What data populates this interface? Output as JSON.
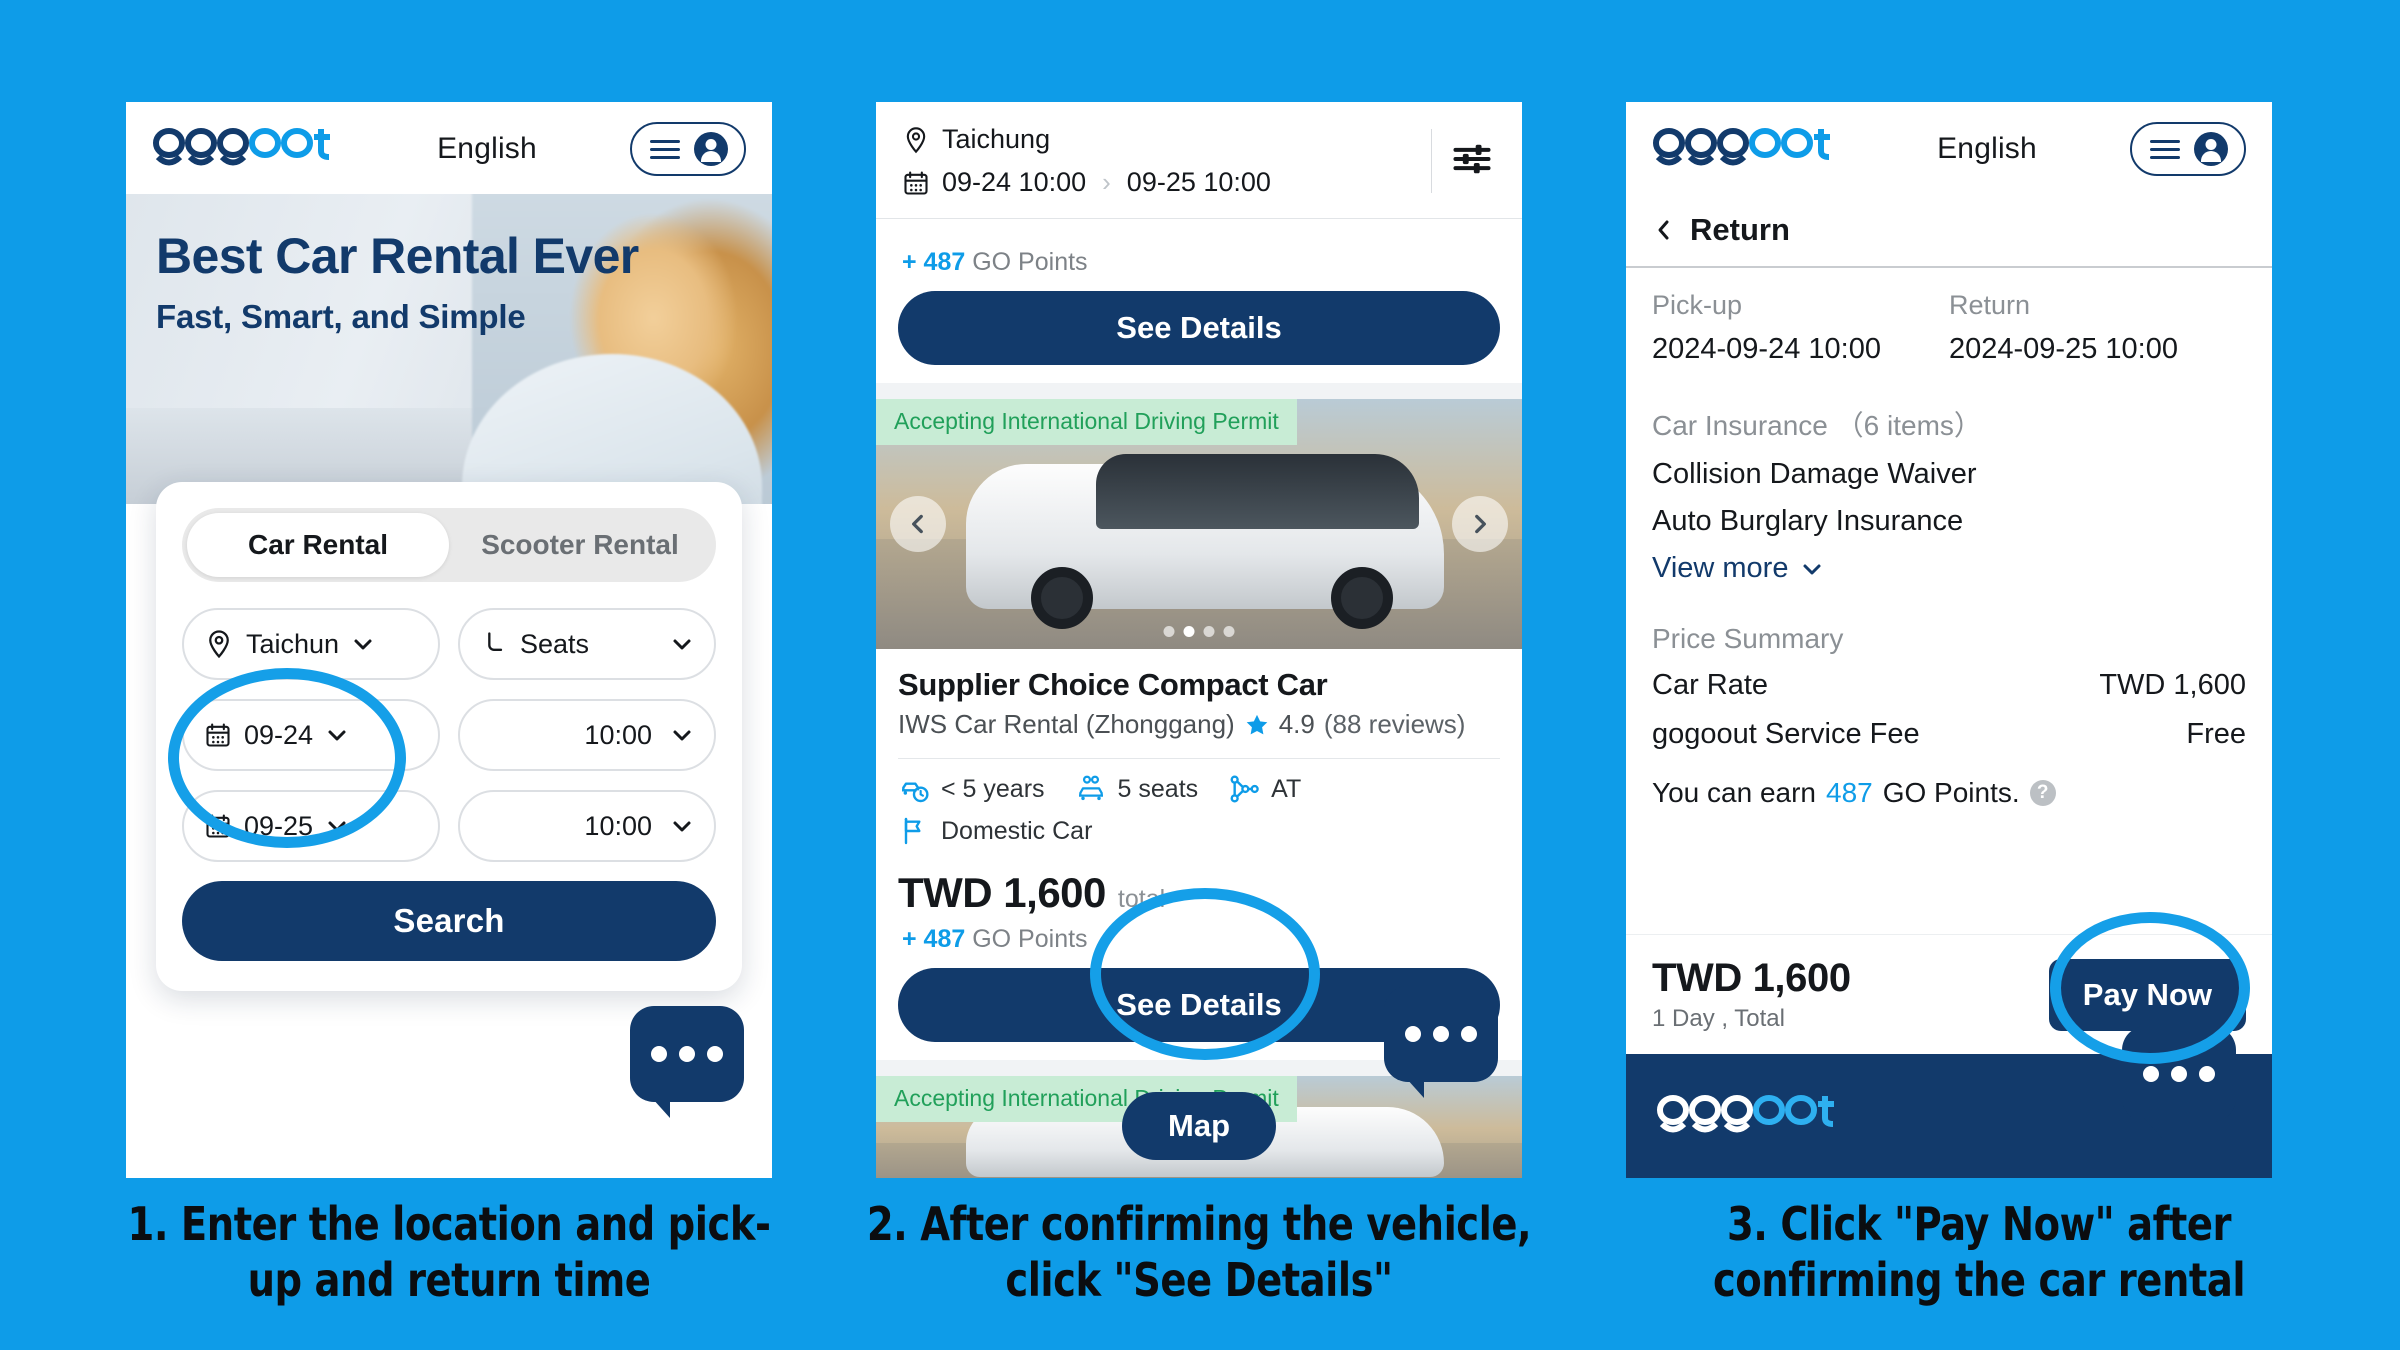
{
  "brand": {
    "name_dark": "gogo",
    "name_light": "out",
    "accent": "#0e9ce8",
    "navy": "#123a6b"
  },
  "panel1": {
    "header": {
      "lang": "English",
      "menu_icon": "hamburger-icon",
      "account_icon": "account-icon"
    },
    "hero": {
      "title": "Best Car Rental Ever",
      "subtitle": "Fast, Smart, and Simple"
    },
    "search": {
      "tabs": [
        {
          "label": "Car Rental",
          "active": true
        },
        {
          "label": "Scooter Rental",
          "active": false
        }
      ],
      "location": "Taichun",
      "seats": "Seats",
      "pickup_date": "09-24",
      "pickup_time": "10:00",
      "return_date": "09-25",
      "return_time": "10:00",
      "submit": "Search"
    }
  },
  "panel2": {
    "topbar": {
      "location": "Taichung",
      "pickup": "09-24 10:00",
      "separator": "›",
      "return": "09-25 10:00",
      "filter_icon": "filter-sliders-icon"
    },
    "card_above": {
      "go_points_prefix": "+ 487",
      "go_points_label": "GO Points",
      "see_details": "See Details"
    },
    "card": {
      "badge": "Accepting International Driving Permit",
      "title": "Supplier Choice Compact Car",
      "supplier": "IWS Car Rental (Zhonggang)",
      "rating": "4.9",
      "reviews": "(88 reviews)",
      "specs": [
        {
          "icon": "car-clock-icon",
          "label": "< 5 years"
        },
        {
          "icon": "car-seats-icon",
          "label": "5 seats"
        },
        {
          "icon": "transmission-icon",
          "label": "AT"
        },
        {
          "icon": "flag-icon",
          "label": "Domestic Car"
        }
      ],
      "price": "TWD 1,600",
      "price_unit": "total",
      "go_points_prefix": "+ 487",
      "go_points_label": "GO Points",
      "see_details": "See Details"
    },
    "card_below": {
      "badge": "Accepting International Driving Permit"
    },
    "map_button": "Map"
  },
  "panel3": {
    "header": {
      "lang": "English"
    },
    "back": "Return",
    "pickup_label": "Pick-up",
    "return_label": "Return",
    "pickup_value": "2024-09-24  10:00",
    "return_value": "2024-09-25  10:00",
    "insurance_heading": "Car Insurance",
    "insurance_count": "（6 items）",
    "insurance_items": [
      "Collision Damage Waiver",
      "Auto Burglary Insurance"
    ],
    "view_more": "View more",
    "price_summary_heading": "Price Summary",
    "price_rows": [
      {
        "label": "Car Rate",
        "value": "TWD 1,600"
      },
      {
        "label": "gogoout Service Fee",
        "value": "Free"
      }
    ],
    "earn_prefix": "You can earn",
    "earn_points": "487",
    "earn_suffix": "GO Points.",
    "help_icon": "question-mark-icon",
    "total": "TWD 1,600",
    "total_sub": "1 Day , Total",
    "pay_button": "Pay Now"
  },
  "captions": [
    "1. Enter the location and pick-up and return time",
    "2. After confirming the vehicle, click \"See Details\"",
    "3. Click \"Pay Now\" after confirming the car rental"
  ]
}
